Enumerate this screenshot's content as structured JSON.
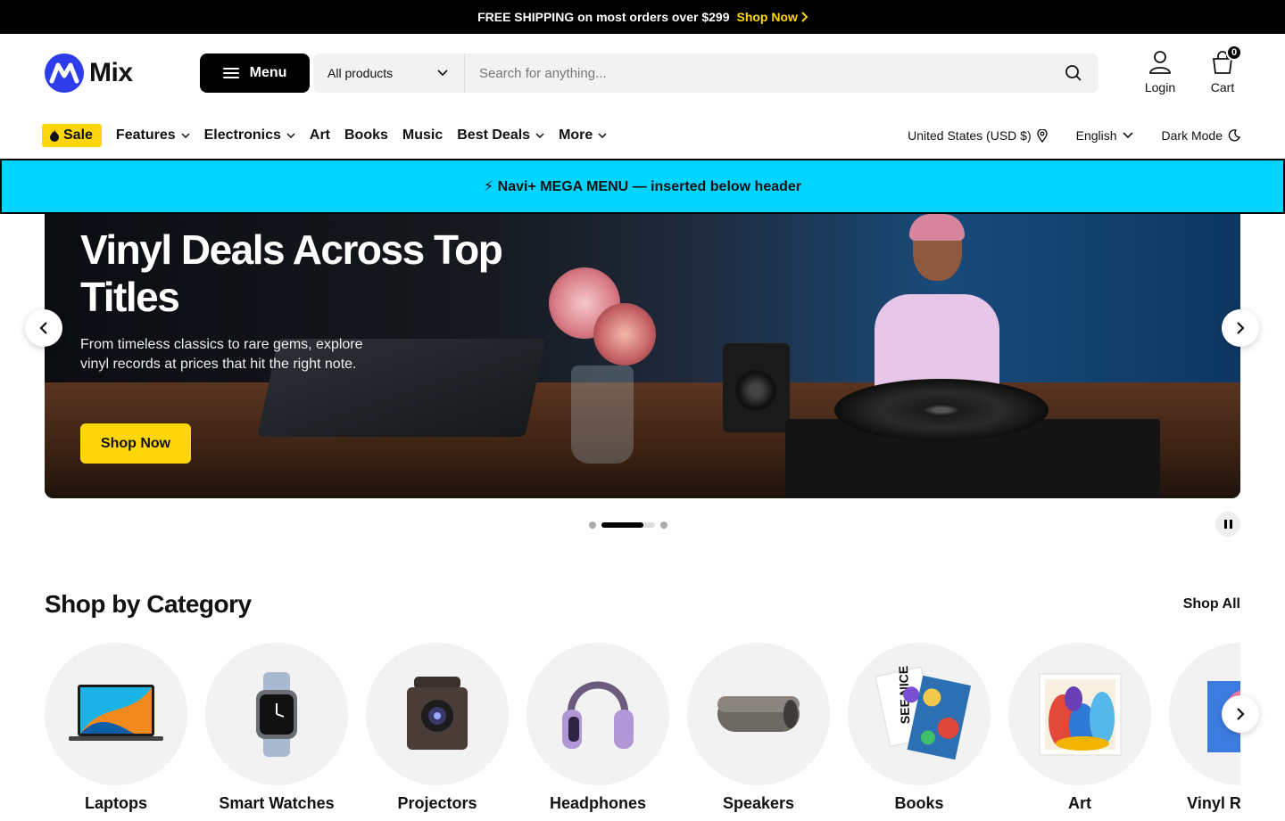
{
  "announcement": {
    "text": "FREE SHIPPING on most orders over $299",
    "link": "Shop Now",
    "link_icon": "chevron-right-icon"
  },
  "header": {
    "logo_text": "Mix",
    "menu_label": "Menu",
    "search_category": "All products",
    "search_placeholder": "Search for anything...",
    "login_label": "Login",
    "cart_label": "Cart",
    "cart_count": "0"
  },
  "nav": {
    "sale": "Sale",
    "items": [
      {
        "label": "Features",
        "dropdown": true
      },
      {
        "label": "Electronics",
        "dropdown": true
      },
      {
        "label": "Art",
        "dropdown": false
      },
      {
        "label": "Books",
        "dropdown": false
      },
      {
        "label": "Music",
        "dropdown": false
      },
      {
        "label": "Best Deals",
        "dropdown": true
      },
      {
        "label": "More",
        "dropdown": true
      }
    ],
    "currency": "United States (USD $)",
    "language": "English",
    "dark_mode": "Dark Mode"
  },
  "mega_banner": {
    "text": "⚡ Navi+ MEGA MENU — inserted below header"
  },
  "hero": {
    "title": "Vinyl Deals Across Top Titles",
    "subtitle": "From timeless classics to rare gems, explore vinyl records at prices that hit the right note.",
    "cta": "Shop Now",
    "slide_count": 3,
    "active_slide": 2,
    "active_slide_progress": 0.78
  },
  "categories": {
    "title": "Shop by Category",
    "shop_all": "Shop All",
    "items": [
      {
        "label": "Laptops",
        "icon": "laptop-icon"
      },
      {
        "label": "Smart Watches",
        "icon": "smartwatch-icon"
      },
      {
        "label": "Projectors",
        "icon": "projector-icon"
      },
      {
        "label": "Headphones",
        "icon": "headphones-icon"
      },
      {
        "label": "Speakers",
        "icon": "speaker-icon"
      },
      {
        "label": "Books",
        "icon": "books-icon"
      },
      {
        "label": "Art",
        "icon": "art-icon"
      },
      {
        "label": "Vinyl Records",
        "icon": "vinyl-icon"
      }
    ]
  },
  "colors": {
    "accent": "#ffd60a",
    "brand": "#2f3cea",
    "mega_banner": "#00d4ff"
  }
}
